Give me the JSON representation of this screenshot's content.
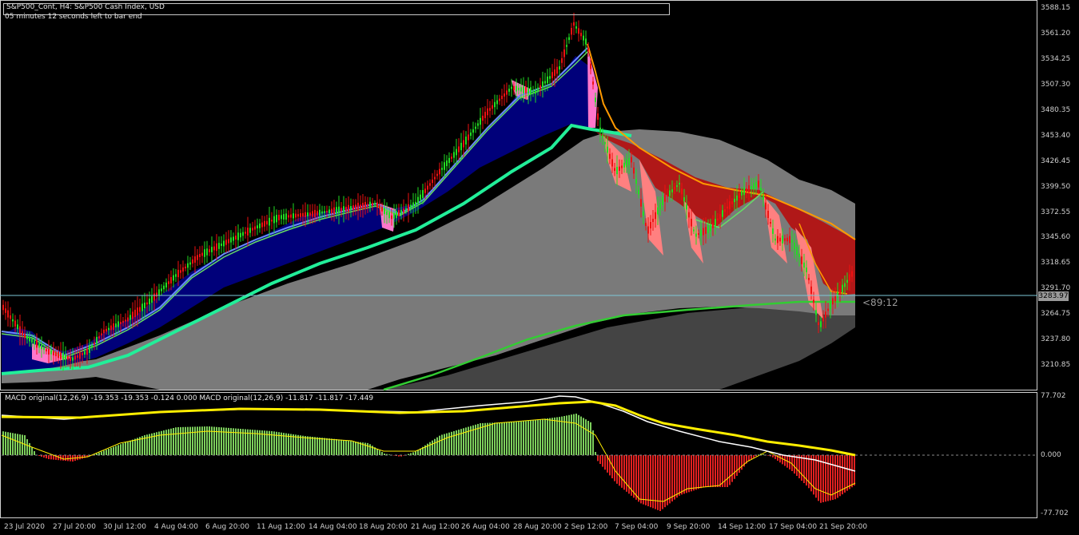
{
  "header": {
    "title": "S&P500_Cont, H4:  S&P500 Cash Index, USD",
    "timer": "05 minutes 12 seconds left to bar end"
  },
  "price_axis": {
    "labels": [
      "3588.15",
      "3561.20",
      "3534.25",
      "3507.30",
      "3480.35",
      "3453.40",
      "3426.45",
      "3399.50",
      "3372.55",
      "3345.60",
      "3318.65",
      "3291.70",
      "3264.75",
      "3237.80",
      "3210.85"
    ],
    "current_price": "3283.97",
    "countdown": "<89:12"
  },
  "macd_panel": {
    "label": "MACD original(12,26,9) -19.353 -19.353 -0.124 0.000 MACD original(12,26,9) -11.817 -11.817 -17.449",
    "axis_labels": [
      "77.702",
      "0.000",
      "-77.702"
    ]
  },
  "time_axis": {
    "labels": [
      "23 Jul 2020",
      "27 Jul 20:00",
      "30 Jul 12:00",
      "4 Aug 04:00",
      "6 Aug 20:00",
      "11 Aug 12:00",
      "14 Aug 04:00",
      "18 Aug 20:00",
      "21 Aug 12:00",
      "26 Aug 04:00",
      "28 Aug 20:00",
      "2 Sep 12:00",
      "7 Sep 04:00",
      "9 Sep 20:00",
      "14 Sep 12:00",
      "17 Sep 04:00",
      "21 Sep 20:00"
    ]
  },
  "colors": {
    "bull_candle": "#22dd22",
    "bear_candle": "#ee1111",
    "up_cloud": "#00007a",
    "down_cloud": "#b01818",
    "gray_band": "#808080",
    "ma_green": "#33cc33",
    "ma_teal": "#22ee99",
    "macd_white": "#ffffff",
    "macd_yellow": "#ffee00"
  }
}
